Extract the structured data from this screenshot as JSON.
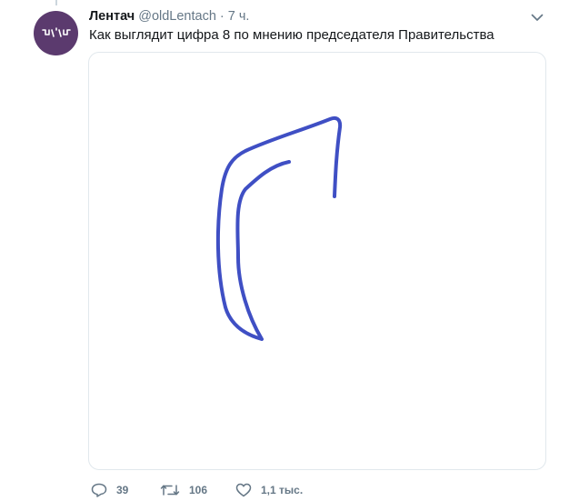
{
  "tweet": {
    "display_name": "Лентач",
    "handle": "@oldLentach",
    "separator": "·",
    "time": "7 ч.",
    "text": "Как выглядит цифра 8 по мнению председателя Правительства",
    "avatar_icon": "lentach-logo-icon",
    "avatar_color": "#5b3a6e",
    "image_description_icon": "hand-drawn-stroke",
    "stroke_color": "#3f4fc4"
  },
  "actions": {
    "reply": {
      "icon": "reply-icon",
      "count": "39"
    },
    "retweet": {
      "icon": "retweet-icon",
      "count": "106"
    },
    "like": {
      "icon": "heart-icon",
      "count": "1,1 тыс."
    }
  },
  "menu": {
    "icon": "chevron-down-icon"
  }
}
